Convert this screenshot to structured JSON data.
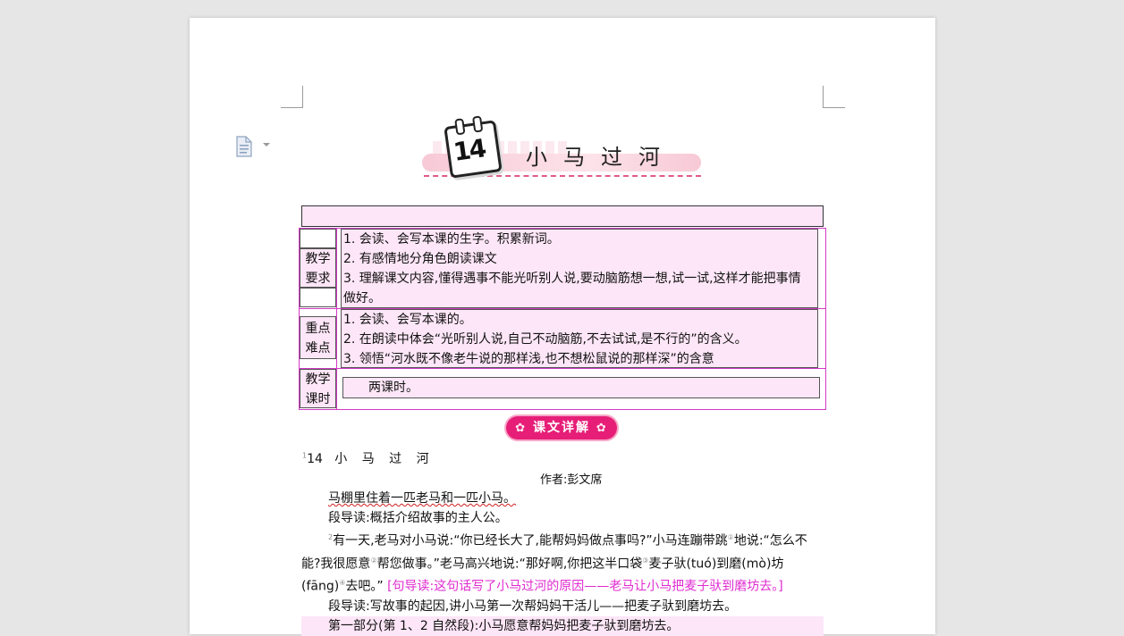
{
  "lesson": {
    "number": "14",
    "title": "小马过河"
  },
  "table": {
    "rows": [
      {
        "label": "教学要求",
        "label_lines": [
          "教学",
          "要求"
        ],
        "lines": [
          "1. 会读、会写本课的生字。积累新词。",
          "2. 有感情地分角色朗读课文",
          "3. 理解课文内容,懂得遇事不能光听别人说,要动脑筋想一想,试一试,这样才能把事情",
          "做好。"
        ]
      },
      {
        "label": "重点难点",
        "label_lines": [
          "重点",
          "难点"
        ],
        "lines": [
          "1. 会读、会写本课的。",
          "2. 在朗读中体会“光听别人说,自己不动脑筋,不去试试,是不行的”的含义。",
          "3. 领悟“河水既不像老牛说的那样浅,也不想松鼠说的那样深”的含意"
        ]
      },
      {
        "label": "教学课时",
        "label_lines": [
          "教学",
          "课时"
        ],
        "lines": [
          "两课时。"
        ]
      }
    ]
  },
  "section_badge": "课文详解",
  "text": {
    "heading_num": "14",
    "heading_title": "小 马 过 河",
    "author": "作者:彭文席",
    "p1": "马棚里住着一匹老马和一匹小马。",
    "p1_guide": "段导读:概括介绍故事的主人公。",
    "p2_a": "有一天,老马对小马说:“你已经长大了,能帮妈妈做点事吗?”小马连蹦带跳",
    "p2_b": "地说:“怎",
    "p2_c": "么不能?我很愿意",
    "p2_d": "帮您做事。”老马高兴地说:“那好啊,你把这半口袋",
    "p2_e": "麦子驮(tuó)到磨(mò)",
    "p2_f": "坊(fāng)",
    "p2_g": "去吧。”",
    "p2_note": "[句导读:这句话写了小马过河的原因——老马让小马把麦子驮到磨坊去。]",
    "p2_guide": "段导读:写故事的起因,讲小马第一次帮妈妈干活儿——把麦子驮到磨坊去。",
    "part1": "第一部分(第 1、2 自然段):小马愿意帮妈妈把麦子驮到磨坊去。"
  }
}
